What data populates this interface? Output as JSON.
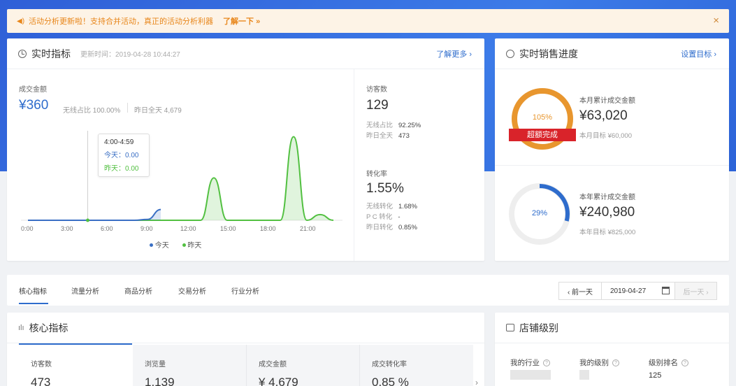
{
  "notice": {
    "text": "活动分析更新啦！支持合并活动，真正的活动分析利器",
    "link": "了解一下 »",
    "close": "×"
  },
  "realtime": {
    "title": "实时指标",
    "update_time": "更新时间：2019-04-28 10:44:27",
    "more": "了解更多 ›",
    "amount_label": "成交金额",
    "amount": "¥360",
    "wireless_ratio": "无线占比 100.00%",
    "yesterday_total": "昨日全天 4,679",
    "tooltip": {
      "time": "4:00-4:59",
      "today": "今天：0.00",
      "yesterday": "昨天：0.00"
    },
    "visitors_label": "访客数",
    "visitors": "129",
    "visitors_kv": [
      {
        "k": "无线占比",
        "v": "92.25%"
      },
      {
        "k": "昨日全天",
        "v": "473"
      }
    ],
    "conv_label": "转化率",
    "conv": "1.55%",
    "conv_kv": [
      {
        "k": "无线转化",
        "v": "1.68%"
      },
      {
        "k": "P C 转化",
        "v": "-"
      },
      {
        "k": "昨日转化",
        "v": "0.85%"
      }
    ],
    "legend_today": "今天",
    "legend_yesterday": "昨天"
  },
  "chart_data": {
    "type": "area",
    "x_ticks": [
      "0:00",
      "3:00",
      "6:00",
      "9:00",
      "12:00",
      "15:00",
      "18:00",
      "21:00"
    ],
    "series": [
      {
        "name": "今天",
        "color": "#3a6fc4",
        "x": [
          0,
          1,
          2,
          3,
          4,
          5,
          6,
          7,
          8,
          9,
          10
        ],
        "y": [
          0,
          0,
          0,
          0,
          0,
          0,
          0,
          0,
          0,
          30,
          360
        ]
      },
      {
        "name": "昨天",
        "color": "#52c041",
        "x": [
          0,
          1,
          2,
          3,
          4,
          5,
          6,
          7,
          8,
          9,
          10,
          11,
          12,
          13,
          14,
          15,
          16,
          17,
          18,
          19,
          20,
          21,
          22,
          23
        ],
        "y": [
          0,
          0,
          0,
          0,
          0,
          0,
          0,
          0,
          0,
          0,
          0,
          0,
          0,
          0,
          1420,
          0,
          0,
          0,
          0,
          0,
          2800,
          0,
          190,
          0
        ]
      }
    ]
  },
  "sales": {
    "title": "实时销售进度",
    "setting": "设置目标 ›",
    "month_pct": "105%",
    "month_badge": "超额完成",
    "month_label": "本月累计成交金额",
    "month_amount": "¥63,020",
    "month_target": "本月目标 ¥60,000",
    "month_ratio": 1.05,
    "year_pct": "29%",
    "year_label": "本年累计成交金额",
    "year_amount": "¥240,980",
    "year_target": "本年目标 ¥825,000",
    "year_ratio": 0.29
  },
  "tabs": [
    "核心指标",
    "流量分析",
    "商品分析",
    "交易分析",
    "行业分析"
  ],
  "date_nav": {
    "prev": "‹ 前一天",
    "date": "2019-04-27",
    "next": "后一天 ›"
  },
  "core": {
    "title": "核心指标",
    "metrics": [
      {
        "label": "访客数",
        "value": "473"
      },
      {
        "label": "浏览量",
        "value": "1,139"
      },
      {
        "label": "成交金额",
        "value": "¥ 4,679"
      },
      {
        "label": "成交转化率",
        "value": "0.85 %"
      }
    ]
  },
  "store": {
    "title": "店铺级别",
    "cols": [
      "我的行业",
      "我的级别",
      "级别排名"
    ],
    "rank": "125"
  },
  "colors": {
    "accent": "#2e6ccc",
    "today": "#3a6fc4",
    "yesterday": "#52c041",
    "orange": "#e8962e",
    "badge": "#d9232a"
  }
}
